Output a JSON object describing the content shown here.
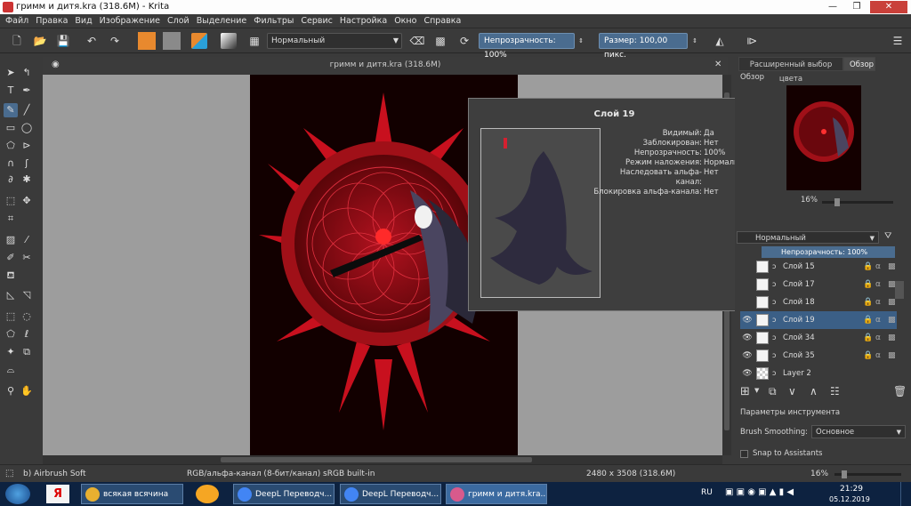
{
  "window": {
    "title": "гримм и дитя.kra (318.6M) - Krita",
    "min": "—",
    "max": "❐",
    "close": "✕"
  },
  "menu": [
    "Файл",
    "Правка",
    "Вид",
    "Изображение",
    "Слой",
    "Выделение",
    "Фильтры",
    "Сервис",
    "Настройка",
    "Окно",
    "Справка"
  ],
  "toolbar": {
    "blend_mode": "Нормальный",
    "opacity_label": "Непрозрачность:",
    "opacity_value": "100%",
    "size_label": "Размер:",
    "size_value": "100,00 пикс.",
    "fg_color": "#e8892e",
    "bg_color": "#8a8a8a"
  },
  "canvas": {
    "tab_title": "гримм и дитя.kra (318.6M)"
  },
  "popup": {
    "title": "Слой 19",
    "rows": [
      {
        "k": "Видимый:",
        "v": "Да"
      },
      {
        "k": "Заблокирован:",
        "v": "Нет"
      },
      {
        "k": "Непрозрачность:",
        "v": "100%"
      },
      {
        "k": "Режим наложения:",
        "v": "Нормальный"
      },
      {
        "k": "Наследовать альфа-",
        "v": "Нет"
      },
      {
        "k": "канал:",
        "v": ""
      },
      {
        "k": "Блокировка альфа-канала:",
        "v": "Нет"
      }
    ]
  },
  "docker": {
    "tabs": [
      "Расширенный выбор цвета",
      "Обзор"
    ],
    "overview_label": "Обзор",
    "zoom": "16%",
    "layers_blend": "Нормальный",
    "layers_opacity": "Непрозрачность:  100%",
    "layers": [
      {
        "name": "Слой 15",
        "selected": false
      },
      {
        "name": "Слой 17",
        "selected": false
      },
      {
        "name": "Слой 18",
        "selected": false
      },
      {
        "name": "Слой 19",
        "selected": true
      },
      {
        "name": "Слой 34",
        "selected": false
      },
      {
        "name": "Слой 35",
        "selected": false
      },
      {
        "name": "Layer 2",
        "selected": false
      }
    ],
    "tool_options_title": "Параметры инструмента",
    "brush_smoothing_label": "Brush Smoothing:",
    "brush_smoothing_value": "Основное",
    "snap_label": "Snap to Assistants"
  },
  "status": {
    "brush": "b) Airbrush Soft",
    "colorspace": "RGB/альфа-канал (8-бит/канал)  sRGB built-in",
    "dimensions": "2480 x 3508 (318.6M)",
    "zoom": "16%"
  },
  "taskbar": {
    "items": [
      {
        "label": "всякая всячина",
        "color": "#e8b030"
      },
      {
        "label": "DeepL Переводч...",
        "color": "#4285f4"
      },
      {
        "label": "DeepL Переводч...",
        "color": "#4285f4"
      },
      {
        "label": "гримм и дитя.kra...",
        "color": "#d85a8c"
      }
    ],
    "lang": "RU",
    "time": "21:29",
    "date": "05.12.2019"
  }
}
